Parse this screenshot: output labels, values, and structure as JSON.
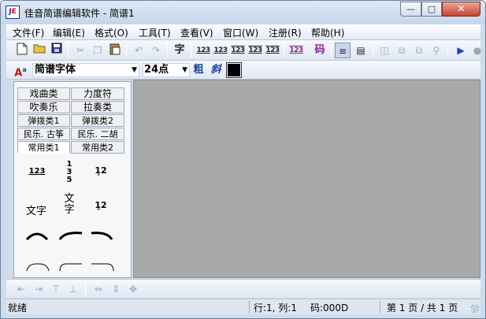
{
  "window": {
    "title": "佳音简谱编辑软件 - 简谱1",
    "logo_text_j": "J",
    "logo_text_e": "E"
  },
  "menu": [
    {
      "label": "文件(F)"
    },
    {
      "label": "编辑(E)"
    },
    {
      "label": "格式(O)"
    },
    {
      "label": "工具(T)"
    },
    {
      "label": "查看(V)"
    },
    {
      "label": "窗口(W)"
    },
    {
      "label": "注册(R)"
    },
    {
      "label": "帮助(H)"
    }
  ],
  "toolbar": {
    "char_button": "字",
    "num_labels": [
      "123",
      "123",
      "123",
      "123",
      "123"
    ],
    "purple_num": "123",
    "code_button": "码"
  },
  "fontbar": {
    "font_icon": "A",
    "font_name": "简谱字体",
    "font_size": "24点",
    "bold": "粗",
    "italic": "斜",
    "color": "#000000"
  },
  "palette": {
    "categories": [
      {
        "label": "戏曲类"
      },
      {
        "label": "力度符"
      },
      {
        "label": "吹奏乐"
      },
      {
        "label": "拉奏类"
      },
      {
        "label": "弹拨类1"
      },
      {
        "label": "弹拨类2"
      },
      {
        "label": "民乐. 古筝"
      },
      {
        "label": "民乐. 二胡"
      },
      {
        "label": "常用类1"
      },
      {
        "label": "常用类2"
      }
    ],
    "active_category": "常用类1",
    "symbols": {
      "s1": "123",
      "s2a": "1",
      "s2b": "3",
      "s2c": "5",
      "s3": "1̣2",
      "s4": "文字",
      "s5a": "文",
      "s5b": "字",
      "s6": "1̱2"
    }
  },
  "status": {
    "ready": "就绪",
    "position": "行:1, 列:1",
    "code": "码:000D",
    "page": "第 1 页 / 共 1 页"
  }
}
